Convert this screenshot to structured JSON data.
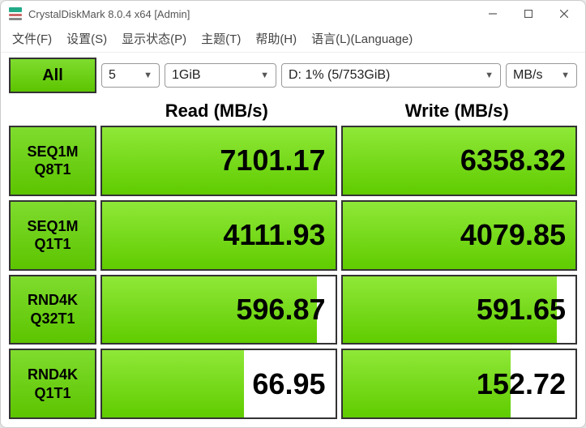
{
  "window": {
    "title": "CrystalDiskMark 8.0.4 x64 [Admin]"
  },
  "menu": {
    "file": "文件(F)",
    "settings": "设置(S)",
    "display": "显示状态(P)",
    "theme": "主题(T)",
    "help": "帮助(H)",
    "language": "语言(L)(Language)"
  },
  "controls": {
    "all": "All",
    "count": "5",
    "size": "1GiB",
    "drive": "D: 1% (5/753GiB)",
    "unit": "MB/s"
  },
  "headers": {
    "read": "Read (MB/s)",
    "write": "Write (MB/s)"
  },
  "tests": [
    {
      "label1": "SEQ1M",
      "label2": "Q8T1",
      "read": "7101.17",
      "write": "6358.32",
      "rfill": 100,
      "wfill": 100
    },
    {
      "label1": "SEQ1M",
      "label2": "Q1T1",
      "read": "4111.93",
      "write": "4079.85",
      "rfill": 100,
      "wfill": 100
    },
    {
      "label1": "RND4K",
      "label2": "Q32T1",
      "read": "596.87",
      "write": "591.65",
      "rfill": 92,
      "wfill": 92
    },
    {
      "label1": "RND4K",
      "label2": "Q1T1",
      "read": "66.95",
      "write": "152.72",
      "rfill": 61,
      "wfill": 72
    }
  ]
}
